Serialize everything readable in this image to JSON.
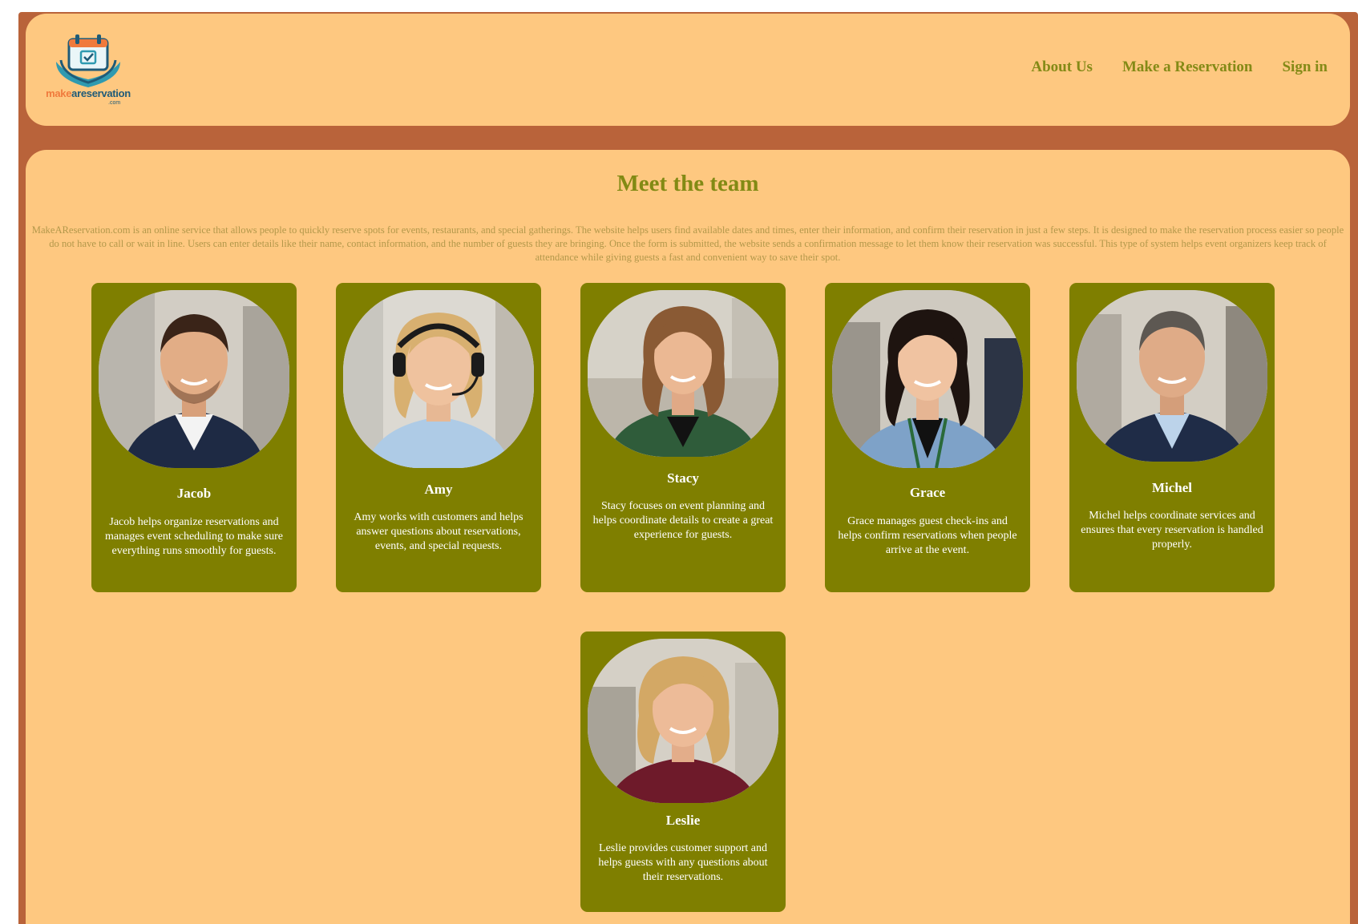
{
  "logo": {
    "text_part1": "make",
    "text_part2": "areservation",
    "text_sub": ".com"
  },
  "nav": {
    "items": [
      "About Us",
      "Make a Reservation",
      "Sign in"
    ]
  },
  "main": {
    "title": "Meet the team",
    "intro": "MakeAReservation.com is an online service that allows people to quickly reserve spots for events, restaurants, and special gatherings. The website helps users find available dates and times, enter their information, and confirm their reservation in just a few steps. It is designed to make the reservation process easier so people do not have to call or wait in line. Users can enter details like their name, contact information, and the number of guests they are bringing. Once the form is submitted, the website sends a confirmation message to let them know their reservation was successful. This type of system helps event organizers keep track of attendance while giving guests a fast and convenient way to save their spot."
  },
  "team": [
    {
      "name": "Jacob",
      "desc": "Jacob helps organize reservations and manages event scheduling to make sure everything runs smoothly for guests."
    },
    {
      "name": "Amy",
      "desc": "Amy works with customers and helps answer questions about reservations, events, and special requests."
    },
    {
      "name": "Stacy",
      "desc": "Stacy focuses on event planning and helps coordinate details to create a great experience for guests."
    },
    {
      "name": "Grace",
      "desc": "Grace manages guest check-ins and helps confirm reservations when people arrive at the event."
    },
    {
      "name": "Michel",
      "desc": "Michel helps coordinate services and ensures that every reservation is handled properly."
    },
    {
      "name": "Leslie",
      "desc": "Leslie provides customer support and helps guests with any questions about their reservations."
    }
  ],
  "colors": {
    "frame": "#b9633a",
    "panel": "#fec880",
    "accent_olive": "#7f7f00",
    "nav_text": "#848a16"
  }
}
